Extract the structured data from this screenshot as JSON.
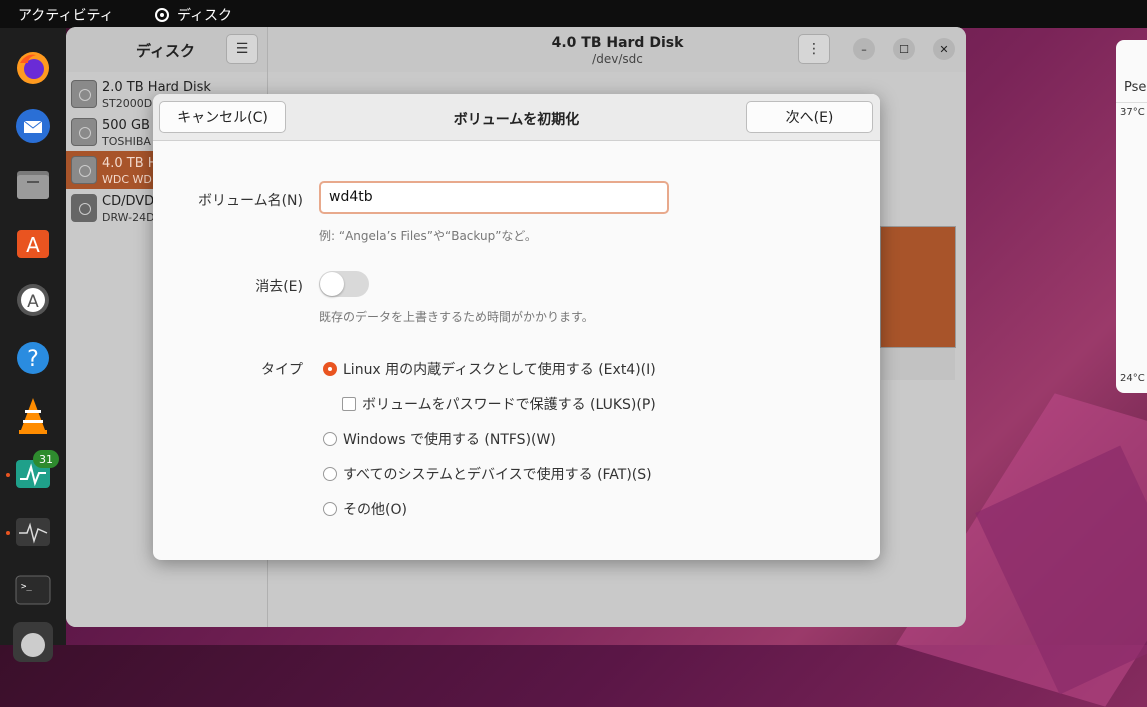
{
  "topbar": {
    "activities": "アクティビティ",
    "app_name": "ディスク"
  },
  "dock": {
    "calendar_badge": "31"
  },
  "disks_window": {
    "sidebar_title": "ディスク",
    "title": "4.0 TB Hard Disk",
    "subtitle": "/dev/sdc",
    "drives": [
      {
        "name": "2.0 TB Hard Disk",
        "model": "ST2000D"
      },
      {
        "name": "500 GB",
        "model": "TOSHIBA"
      },
      {
        "name": "4.0 TB H",
        "model": "WDC WD"
      },
      {
        "name": "CD/DVD",
        "model": "DRW-24D"
      }
    ]
  },
  "right_window": {
    "header": "Pse",
    "temp_top": "37°C",
    "temp_bottom": "24°C"
  },
  "dialog": {
    "cancel_label": "キャンセル(C)",
    "title": "ボリュームを初期化",
    "next_label": "次へ(E)",
    "volume_name_label": "ボリューム名(N)",
    "volume_name_value": "wd4tb",
    "volume_name_hint": "例: “Angela’s Files”や“Backup”など。",
    "erase_label": "消去(E)",
    "erase_hint": "既存のデータを上書きするため時間がかかります。",
    "type_label": "タイプ",
    "options": {
      "ext4": "Linux 用の内蔵ディスクとして使用する (Ext4)(I)",
      "luks": "ボリュームをパスワードで保護する (LUKS)(P)",
      "ntfs": "Windows で使用する (NTFS)(W)",
      "fat": "すべてのシステムとデバイスで使用する (FAT)(S)",
      "other": "その他(O)"
    },
    "selected_type": "ext4"
  }
}
